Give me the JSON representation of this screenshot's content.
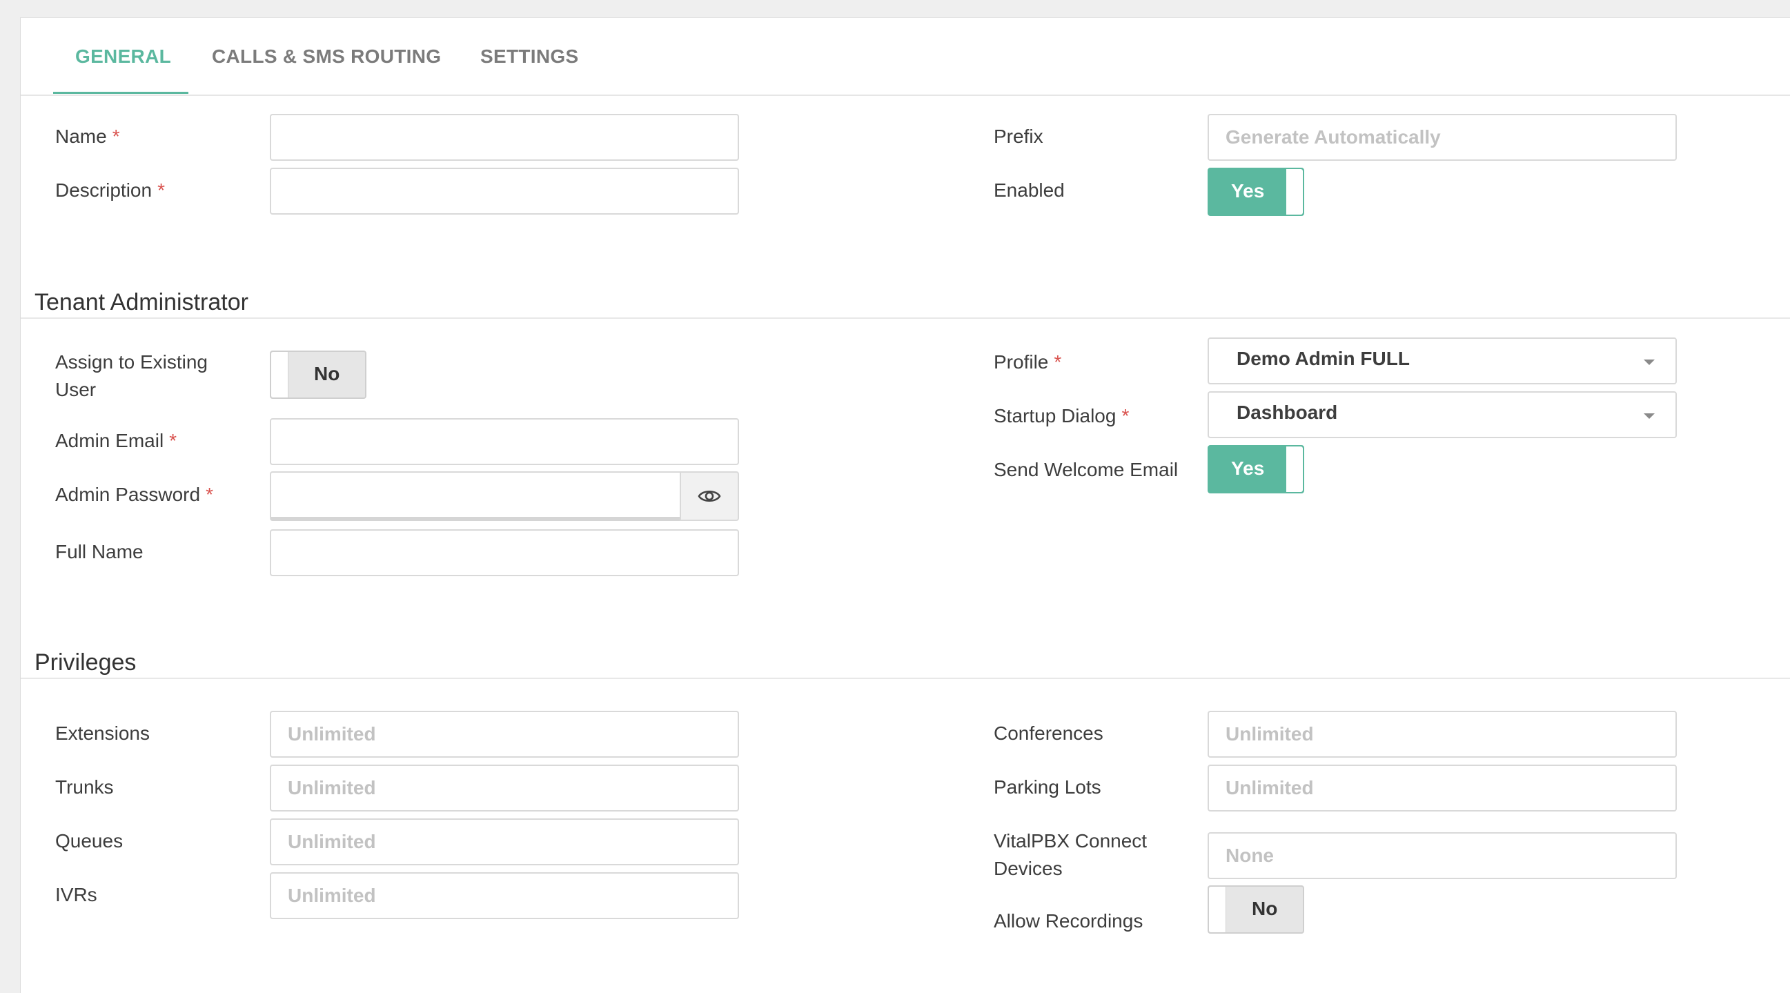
{
  "tabs": [
    {
      "label": "GENERAL",
      "active": true
    },
    {
      "label": "CALLS & SMS ROUTING",
      "active": false
    },
    {
      "label": "SETTINGS",
      "active": false
    }
  ],
  "general": {
    "name_label": "Name",
    "description_label": "Description",
    "prefix_label": "Prefix",
    "prefix_placeholder": "Generate Automatically",
    "enabled_label": "Enabled",
    "enabled_value": "Yes",
    "required_mark": "*"
  },
  "tenant_admin": {
    "title": "Tenant Administrator",
    "assign_label_line1": "Assign to Existing",
    "assign_label_line2": "User",
    "assign_value": "No",
    "admin_email_label": "Admin Email",
    "admin_password_label": "Admin Password",
    "full_name_label": "Full Name",
    "profile_label": "Profile",
    "profile_value": "Demo Admin FULL",
    "startup_label": "Startup Dialog",
    "startup_value": "Dashboard",
    "welcome_label": "Send Welcome Email",
    "welcome_value": "Yes"
  },
  "privileges": {
    "title": "Privileges",
    "extensions_label": "Extensions",
    "trunks_label": "Trunks",
    "queues_label": "Queues",
    "ivrs_label": "IVRs",
    "conferences_label": "Conferences",
    "parking_label": "Parking Lots",
    "connect_label_line1": "VitalPBX Connect",
    "connect_label_line2": "Devices",
    "recordings_label": "Allow Recordings",
    "recordings_value": "No",
    "unlimited_placeholder": "Unlimited",
    "none_placeholder": "None"
  },
  "colors": {
    "accent": "#5bb89f",
    "required": "#d9534f"
  }
}
